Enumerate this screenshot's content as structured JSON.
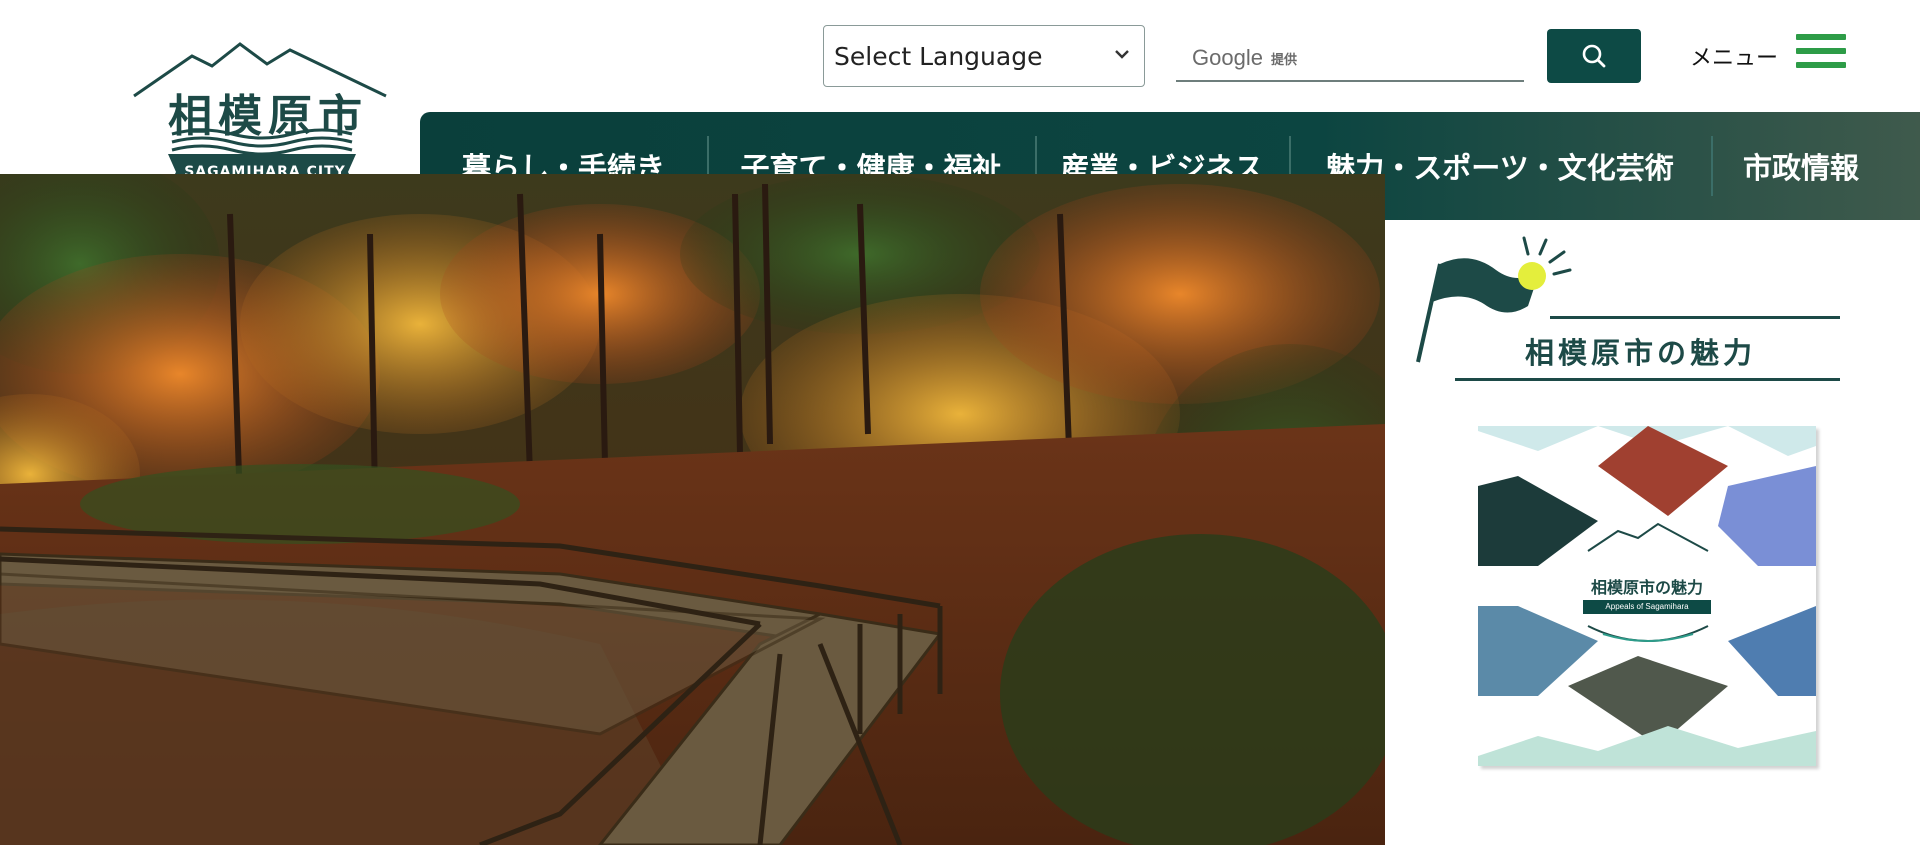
{
  "logo": {
    "title": "相模原市",
    "subtitle": "SAGAMIHARA CITY"
  },
  "header": {
    "language_select": {
      "selected": "Select Language"
    },
    "search": {
      "provider": "Google",
      "provider_suffix": "提供"
    },
    "menu_label": "メニュー"
  },
  "nav": {
    "items": [
      {
        "label": "暮らし・手続き"
      },
      {
        "label": "子育て・健康・福祉"
      },
      {
        "label": "産業・ビジネス"
      },
      {
        "label": "魅力・スポーツ・文化芸術"
      },
      {
        "label": "市政情報"
      }
    ]
  },
  "side": {
    "charm_title": "相模原市の魅力",
    "banner": {
      "title": "相模原市の魅力",
      "subtitle": "Appeals of Sagamihara"
    }
  },
  "colors": {
    "brand_dark_green": "#0d4a45",
    "menu_green": "#2d9c47",
    "text_dark": "#1d4a47"
  },
  "icons": {
    "search": "search-icon",
    "menu": "hamburger-menu-icon",
    "select_caret": "chevron-down-icon",
    "charm": "flag-icon"
  }
}
